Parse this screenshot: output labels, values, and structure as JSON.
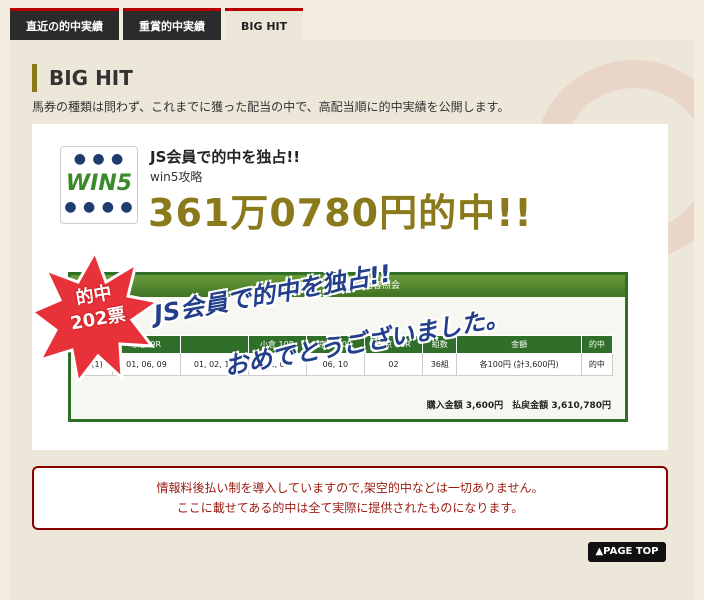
{
  "tabs": [
    {
      "label": "直近の的中実績"
    },
    {
      "label": "重賞的中実績"
    },
    {
      "label": "BIG HIT"
    }
  ],
  "section": {
    "title": "BIG HIT",
    "description": "馬券の種類は問わず、これまでに獲った配当の中で、高配当順に的中実績を公開します。"
  },
  "hit": {
    "logo_text": "WIN5",
    "title": "JS会員で的中を独占!!",
    "subtitle": "win5攻略",
    "amount": "361万0780円的中!!",
    "badge_line1": "的中",
    "badge_line2": "202票",
    "overlay_line1": "JS会員で的中を独占!!",
    "overlay_line2": "おめでとうございました。",
    "ticket": {
      "header": "IPAT　Win5投票内容照会",
      "columns": [
        "件番",
        "京都 9R",
        "",
        "小倉 10R",
        "京都 10R",
        "東京 10R",
        "組数",
        "金額",
        "的中"
      ],
      "row": [
        "(1)",
        "01, 06, 09",
        "01, 02, 14",
        "01, 05",
        "06, 10",
        "02",
        "36組",
        "各100円 (計3,600円)",
        "的中"
      ],
      "total": "購入金額 3,600円　払戻金額 3,610,780円"
    }
  },
  "notice": {
    "line1": "情報料後払い制を導入していますので,架空的中などは一切ありません。",
    "line2": "ここに載せてある的中は全て実際に提供されたものになります。"
  },
  "pagetop_label": "▲PAGE TOP",
  "colors": {
    "accent": "#8a7a1c",
    "notice": "#8a0000",
    "ticket": "#2f6f2a",
    "overlay": "#233f8c"
  }
}
